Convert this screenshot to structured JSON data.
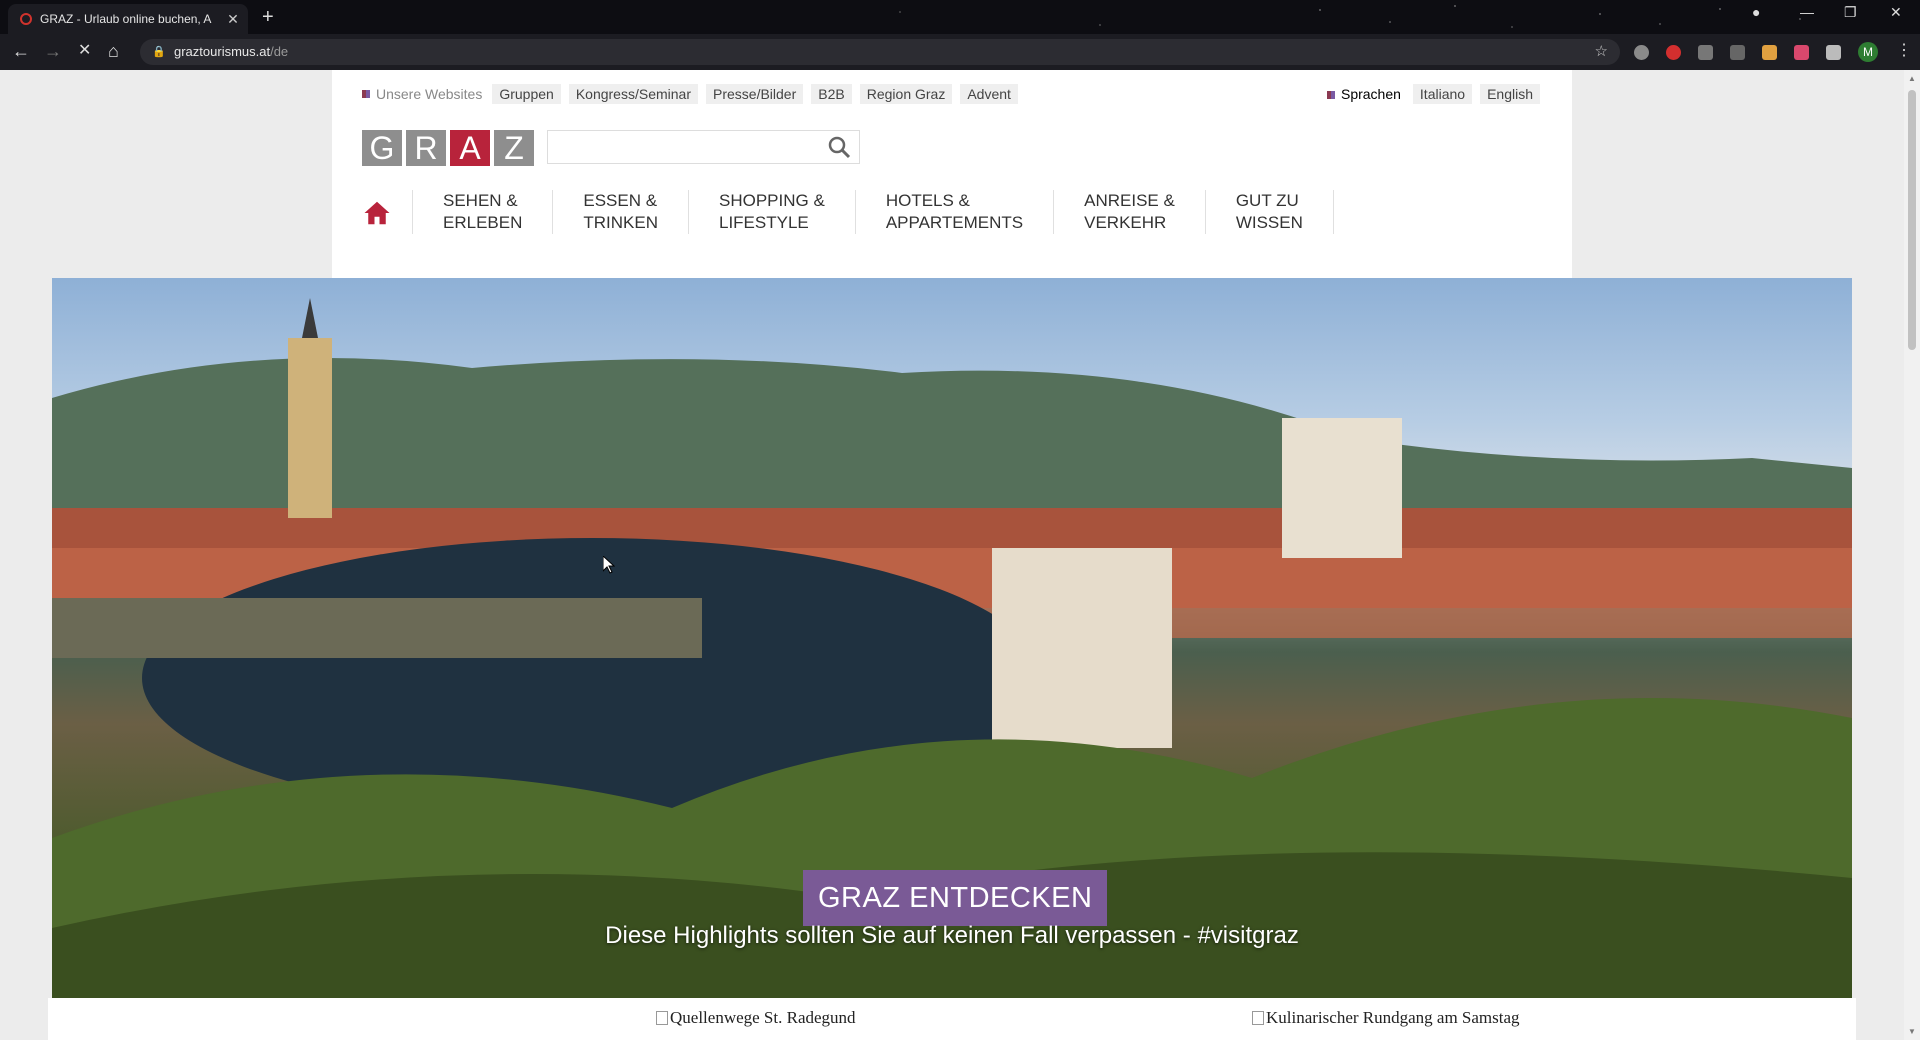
{
  "browser": {
    "tab_title": "GRAZ - Urlaub online buchen, A",
    "tab_close": "✕",
    "new_tab": "+",
    "url_host": "graztourismus.at",
    "url_path": "/de",
    "avatar_letter": "M"
  },
  "header": {
    "websites_label": "Unsere Websites",
    "top_links": [
      "Gruppen",
      "Kongress/Seminar",
      "Presse/Bilder",
      "B2B",
      "Region Graz",
      "Advent"
    ],
    "languages_label": "Sprachen",
    "languages": [
      "Italiano",
      "English"
    ],
    "logo_letters": [
      "G",
      "R",
      "A",
      "Z"
    ],
    "search_placeholder": ""
  },
  "nav": {
    "items": [
      {
        "line1": "SEHEN &",
        "line2": "ERLEBEN"
      },
      {
        "line1": "ESSEN &",
        "line2": "TRINKEN"
      },
      {
        "line1": "SHOPPING &",
        "line2": "LIFESTYLE"
      },
      {
        "line1": "HOTELS &",
        "line2": "APPARTEMENTS"
      },
      {
        "line1": "ANREISE &",
        "line2": "VERKEHR"
      },
      {
        "line1": "GUT ZU",
        "line2": "WISSEN"
      }
    ]
  },
  "hero": {
    "button": "GRAZ ENTDECKEN",
    "subtitle": "Diese Highlights sollten Sie auf keinen Fall verpassen - #visitgraz"
  },
  "cards": [
    {
      "alt": "Quellenwege St. Radegund"
    },
    {
      "alt": "Kulinarischer Rundgang am Samstag"
    }
  ],
  "colors": {
    "brand_red": "#b8233b",
    "accent_purple": "#7a5a96",
    "logo_gray": "#8e8e8e"
  }
}
